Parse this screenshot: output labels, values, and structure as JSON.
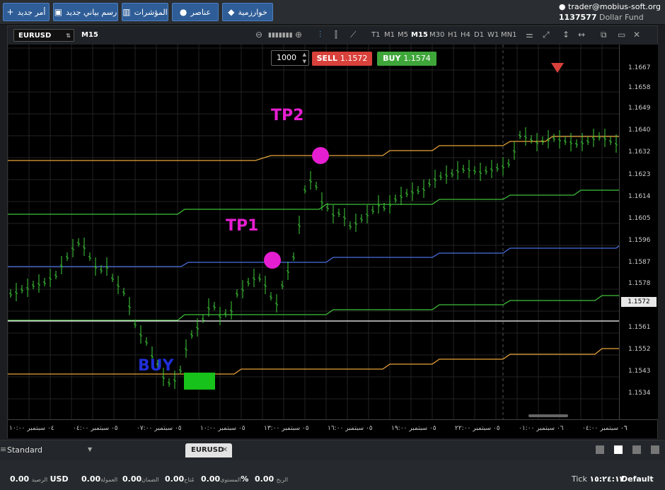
{
  "toolbar": {
    "btn_new_order": "أمر جديد",
    "btn_new_chart": "رسم بياني جديد",
    "btn_indicators": "المؤشرات",
    "btn_elements": "عناصر",
    "btn_algo": "خوارزمية"
  },
  "account": {
    "user": "trader@mobius-soft.org",
    "number": "1137577",
    "fund": "Dollar Fund"
  },
  "chart_toolbar": {
    "symbol": "EURUSD",
    "timeframe_current": "M15",
    "timeframes": [
      "T1",
      "M1",
      "M5",
      "M15",
      "M30",
      "H1",
      "H4",
      "D1",
      "W1",
      "MN1"
    ],
    "active_timeframe": "M15"
  },
  "trade_panel": {
    "quantity": "1000",
    "sell_label": "SELL",
    "sell_price": "1.1572",
    "buy_label": "BUY",
    "buy_price": "1.1574"
  },
  "annotations": {
    "tp2": "TP2",
    "tp1": "TP1",
    "buy": "BUY",
    "colors": {
      "tp": "#e61ed1",
      "buy": "#1f2fd6",
      "box": "#17c21a"
    }
  },
  "price_axis": [
    "1.1667",
    "1.1658",
    "1.1649",
    "1.1640",
    "1.1632",
    "1.1623",
    "1.1614",
    "1.1605",
    "1.1596",
    "1.1587",
    "1.1578",
    "1.1561",
    "1.1552",
    "1.1543",
    "1.1534"
  ],
  "current_price": "1.1572",
  "time_axis": [
    "٠٤ سبتمبر ١٠:٠٠",
    "٠٥ سبتمبر ٠٤:٠٠",
    "٠٥ سبتمبر ٠٧:٠٠",
    "٠٥ سبتمبر ١٠:٠٠",
    "٠٥ سبتمبر ١٣:٠٠",
    "٠٥ سبتمبر ١٦:٠٠",
    "٠٥ سبتمبر ١٩:٠٠",
    "٠٥ سبتمبر ٢٢:٠٠",
    "٠٦ سبتمبر ٠١:٠٠",
    "٠٦ سبتمبر ٠٤:٠٠",
    "٠٦"
  ],
  "chart_data": {
    "type": "line",
    "title": "",
    "ylim": [
      1.1528,
      1.1675
    ],
    "price_ticks": [
      1.1667,
      1.1658,
      1.1649,
      1.164,
      1.1632,
      1.1623,
      1.1614,
      1.1605,
      1.1596,
      1.1587,
      1.1578,
      1.1561,
      1.1552,
      1.1543,
      1.1534
    ],
    "current_price": 1.1572,
    "series_colors": [
      "#e8a33a",
      "#3fbf3a",
      "#4a6fe0",
      "#3fbf3a",
      "#e8a33a"
    ],
    "bars_color": "#3fcf3a"
  },
  "bottom_tabs": {
    "workspace": "Standard",
    "tab": "EURUSD"
  },
  "statusbar": {
    "balance_label": "الرصيد",
    "balance": "0.00",
    "currency": "USD",
    "commission_label": "العمولة",
    "commission": "0.00",
    "margin_label": "الضمان",
    "margin": "0.00",
    "available_label": "مُتاح",
    "available": "0.00",
    "level_label": "المستوى",
    "level": "0.00",
    "level_pct": "%",
    "profit_label": "الربح",
    "profit": "0.00",
    "tick_label": "Tick",
    "tick_time": "١٥:٢٤:١٣",
    "default_label": "Default"
  }
}
